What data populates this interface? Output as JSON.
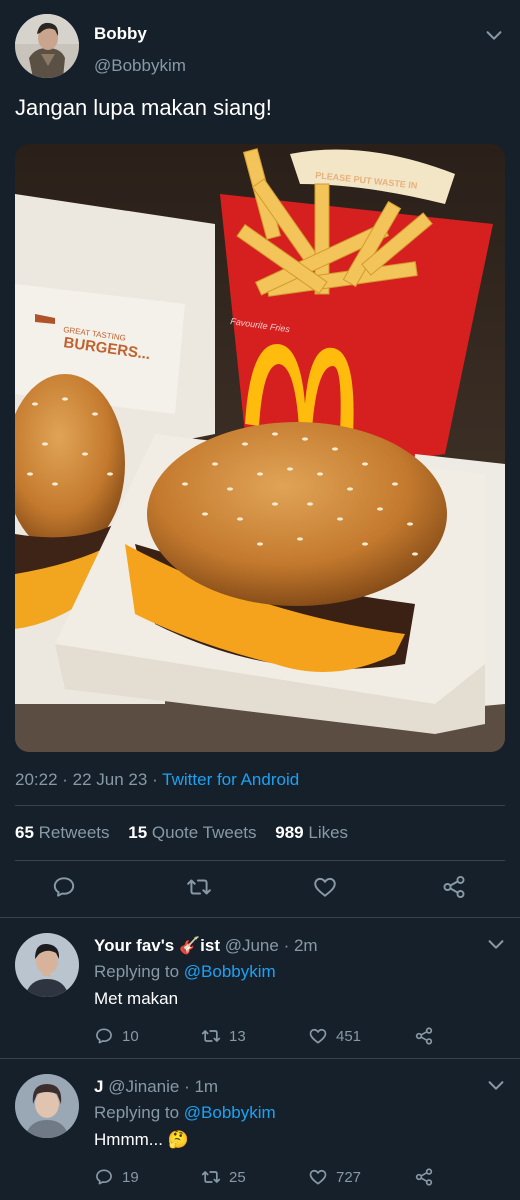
{
  "tweet": {
    "author_name": "Bobby",
    "author_handle": "@Bobbykim",
    "text": "Jangan lupa makan siang!",
    "time": "20:22",
    "date": "22 Jun 23",
    "source": "Twitter for Android",
    "media": {
      "photo_texts": [
        "PLEASE PUT WASTE IN",
        "GREAT TASTING",
        "BURGERS...",
        "Favourite Fries"
      ]
    },
    "stats": {
      "retweets_count": "65",
      "retweets_label": "Retweets",
      "quotes_count": "15",
      "quotes_label": "Quote Tweets",
      "likes_count": "989",
      "likes_label": "Likes"
    }
  },
  "replies": [
    {
      "name": "Your fav's 🎸ist",
      "handle": "@June",
      "time": "2m",
      "replying_label": "Replying to",
      "replying_to": "@Bobbykim",
      "text": "Met makan",
      "replies": "10",
      "retweets": "13",
      "likes": "451"
    },
    {
      "name": "J",
      "handle": "@Jinanie",
      "time": "1m",
      "replying_label": "Replying to",
      "replying_to": "@Bobbykim",
      "text": "Hmmm... 🤔",
      "replies": "19",
      "retweets": "25",
      "likes": "727"
    }
  ],
  "icons": [
    "chevron-down-icon",
    "reply-icon",
    "retweet-icon",
    "like-icon",
    "share-icon"
  ],
  "colors": {
    "background": "#15202b",
    "muted": "#8899a6",
    "link": "#1da1f2",
    "divider": "#38444d"
  }
}
